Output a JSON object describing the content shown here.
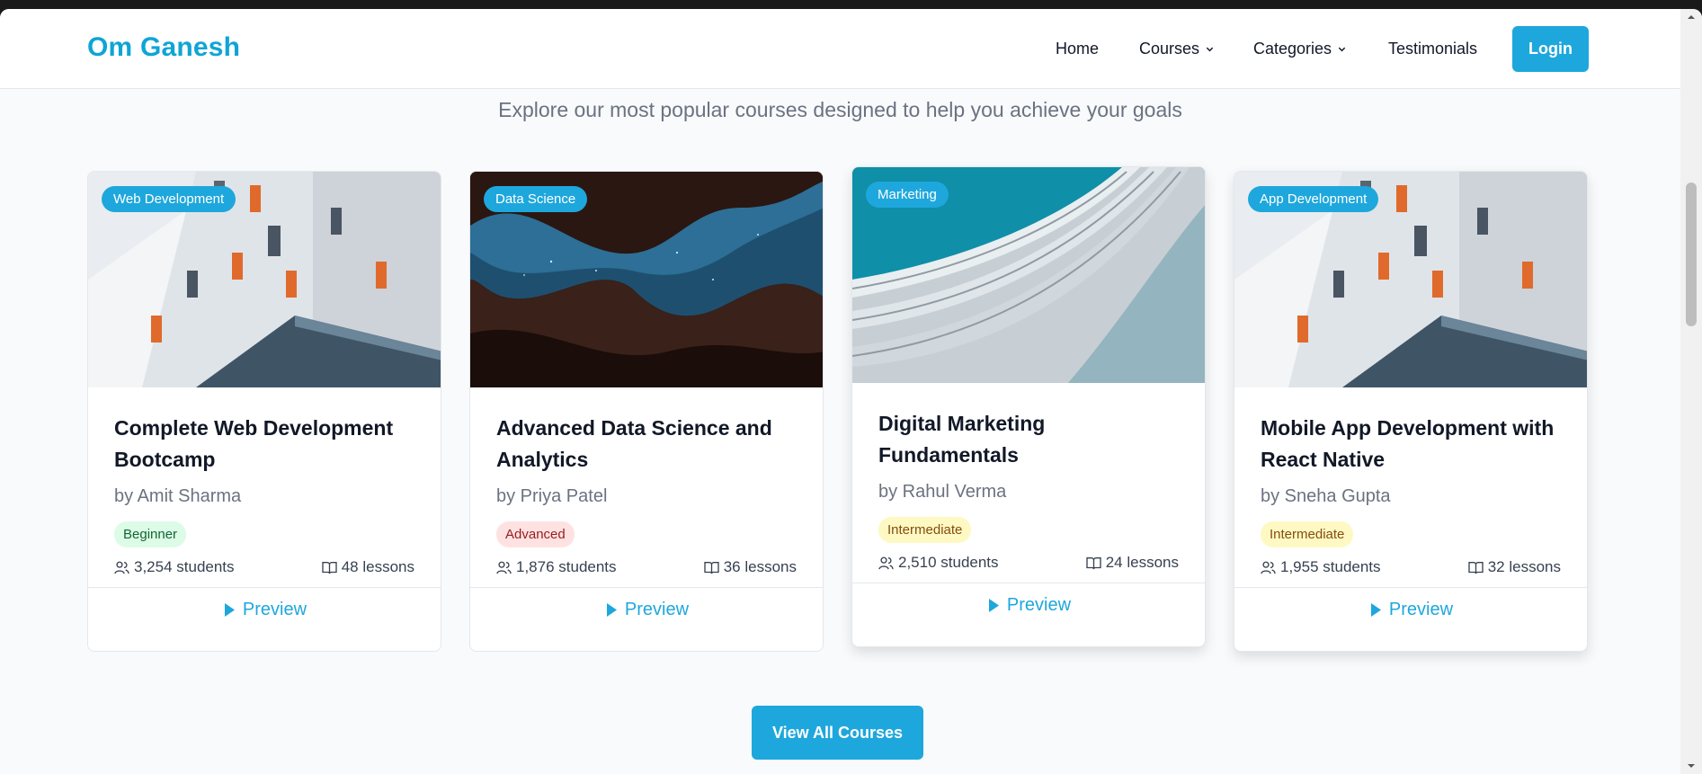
{
  "nav": {
    "brand": "Om Ganesh",
    "home": "Home",
    "courses": "Courses",
    "categories": "Categories",
    "testimonials": "Testimonials",
    "login": "Login"
  },
  "section": {
    "subtitle": "Explore our most popular courses designed to help you achieve your goals",
    "view_all": "View All Courses"
  },
  "colors": {
    "accent": "#1ea7dc",
    "brand": "#0ea5d6"
  },
  "courses": [
    {
      "category": "Web Development",
      "title": "Complete Web Development Bootcamp",
      "author": "by Amit Sharma",
      "level": "Beginner",
      "students": "3,254 students",
      "lessons": "48 lessons",
      "preview": "Preview"
    },
    {
      "category": "Data Science",
      "title": "Advanced Data Science and Analytics",
      "author": "by Priya Patel",
      "level": "Advanced",
      "students": "1,876 students",
      "lessons": "36 lessons",
      "preview": "Preview"
    },
    {
      "category": "Marketing",
      "title": "Digital Marketing Fundamentals",
      "author": "by Rahul Verma",
      "level": "Intermediate",
      "students": "2,510 students",
      "lessons": "24 lessons",
      "preview": "Preview"
    },
    {
      "category": "App Development",
      "title": "Mobile App Development with React Native",
      "author": "by Sneha Gupta",
      "level": "Intermediate",
      "students": "1,955 students",
      "lessons": "32 lessons",
      "preview": "Preview"
    }
  ]
}
